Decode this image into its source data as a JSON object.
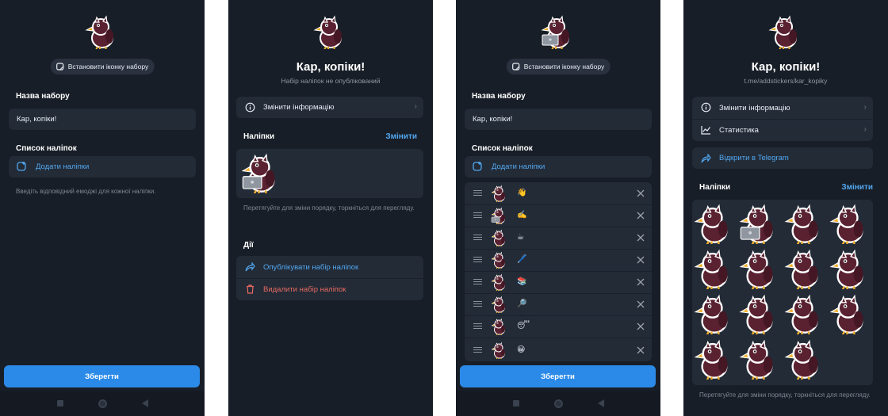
{
  "colors": {
    "background": "#181e27",
    "card": "#232b37",
    "accent": "#52a8f0",
    "button": "#2b8ae8",
    "danger": "#e86a60"
  },
  "icons": {
    "sticker_add": "sticker-plus-icon",
    "info": "info-icon",
    "stats": "chart-icon",
    "share": "share-arrow-icon",
    "trash": "trash-icon",
    "drag": "drag-handle-icon",
    "remove": "close-icon"
  },
  "screen1": {
    "set_icon_button": "Встановити іконку набору",
    "name_label": "Назва набору",
    "name_value": "Кар, копіки!",
    "list_label": "Список наліпок",
    "add_stickers": "Додати наліпки",
    "hint": "Введіть відповідний емоджі для кожної наліпки.",
    "save": "Зберегти"
  },
  "screen2": {
    "title": "Кар, копіки!",
    "subtitle": "Набір наліпок не опублікований",
    "change_info": "Змінити інформацію",
    "stickers_label": "Наліпки",
    "edit": "Змінити",
    "hint": "Перетягуйте для зміни порядку, торкніться для перегляду.",
    "actions_label": "Дії",
    "publish": "Опублікувати набір наліпок",
    "delete": "Видалити набір наліпок"
  },
  "screen3": {
    "set_icon_button": "Встановити іконку набору",
    "name_label": "Назва набору",
    "name_value": "Кар, копіки!",
    "list_label": "Список наліпок",
    "add_stickers": "Додати наліпки",
    "sticker_emojis": [
      "👋",
      "✍️",
      "☕",
      "🖊️",
      "📚",
      "🔎",
      "😴",
      "😀"
    ],
    "save": "Зберегти"
  },
  "screen4": {
    "title": "Кар, копіки!",
    "link": "t.me/addstickers/kar_kopiky",
    "change_info": "Змінити інформацію",
    "statistics": "Статистика",
    "open_telegram": "Відкрити в Telegram",
    "stickers_label": "Наліпки",
    "edit": "Змінити",
    "hint": "Перетягуйте для зміни порядку, торкніться для перегляду."
  }
}
